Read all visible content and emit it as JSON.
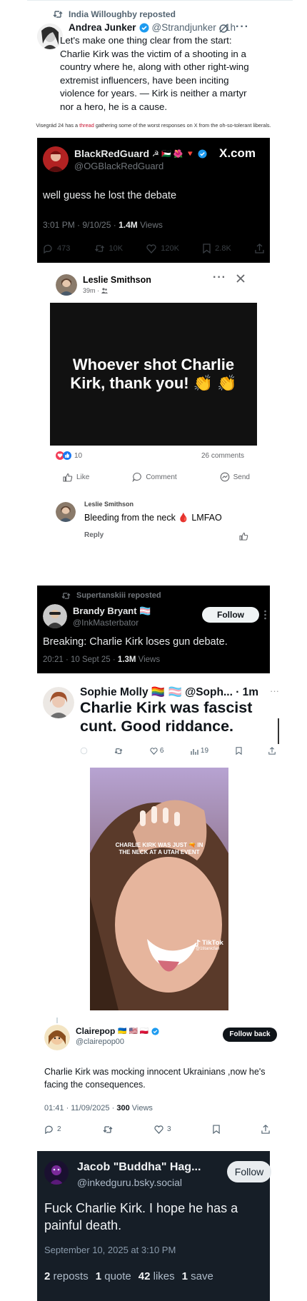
{
  "tweet1": {
    "reposted_by": "India Willoughby reposted",
    "name": "Andrea Junker",
    "handle": "@Strandjunker",
    "time": "· 1h",
    "text": "Let's make one thing clear from the start: Charlie Kirk was the victim of a shooting in a country where he, along with other right-wing extremist influencers, have been inciting violence for years. — Kirk is neither a martyr nor a hero, he is a cause."
  },
  "caption": {
    "before": "Visegrád 24 has a ",
    "link": "thread",
    "after": " gathering some of the worst responses on X from the oh-so-tolerant liberals."
  },
  "card1": {
    "name": "BlackRedGuard",
    "emoji": "☭ 🇵🇸 🌺 🔻",
    "handle": "@OGBlackRedGuard",
    "site": "X.com",
    "text": "well guess he lost the debate",
    "time": "3:01 PM · 9/10/25 · ",
    "views_count": "1.4M",
    "views_label": " Views",
    "replies": "473",
    "reposts": "10K",
    "likes": "120K",
    "bookmarks": "2.8K"
  },
  "card2": {
    "name": "Leslie Smithson",
    "time": "39m ·",
    "image_text": "Whoever shot Charlie Kirk, thank you! 👏 👏",
    "reaction_count": "10",
    "comments": "26 comments",
    "like_label": "Like",
    "comment_label": "Comment",
    "send_label": "Send",
    "commenter": "Leslie Smithson",
    "comment_text": "Bleeding from the neck 🩸 LMFAO",
    "reply_label": "Reply"
  },
  "card3": {
    "reposted_by": "Supertanskiii reposted",
    "name": "Brandy Bryant 🏳️‍⚧️",
    "handle": "@InkMasterbator",
    "follow_label": "Follow",
    "text": "Breaking: Charlie Kirk loses gun debate.",
    "time": "20:21 · 10 Sept 25 · ",
    "views_count": "1.3M",
    "views_label": " Views"
  },
  "card4": {
    "name": "Sophie Molly 🏳️‍🌈 🏳️‍⚧️ @Soph... · 1m",
    "text": "Charlie Kirk was fascist cunt. Good riddance.",
    "likes": "6",
    "views": "19",
    "video_overlay": "CHARLIE KIRK WAS JUST 🔫 IN THE NECK AT A UTAH EVENT",
    "tiktok_label": "TikTok",
    "tiktok_handle": "@1titanicfan"
  },
  "card5": {
    "name": "Clairepop",
    "flags": "🇺🇦 🇺🇸 🇵🇱",
    "handle": "@clairepop00",
    "follow_label": "Follow back",
    "text": "Charlie Kirk was mocking innocent Ukrainians ,now he's facing the consequences.",
    "time": "01:41 · 11/09/2025 · ",
    "views_count": "300",
    "views_label": " Views",
    "replies": "2",
    "likes": "3"
  },
  "card6": {
    "name": "Jacob \"Buddha\" Hag...",
    "handle": "@inkedguru.bsky.social",
    "follow_label": "Follow",
    "text": "Fuck Charlie Kirk. I hope he has a painful death.",
    "time": "September 10, 2025 at 3:10 PM",
    "reposts_count": "2",
    "reposts_label": "reposts",
    "quotes_count": "1",
    "quotes_label": "quote",
    "likes_count": "42",
    "likes_label": "likes",
    "saves_count": "1",
    "saves_label": "save"
  }
}
